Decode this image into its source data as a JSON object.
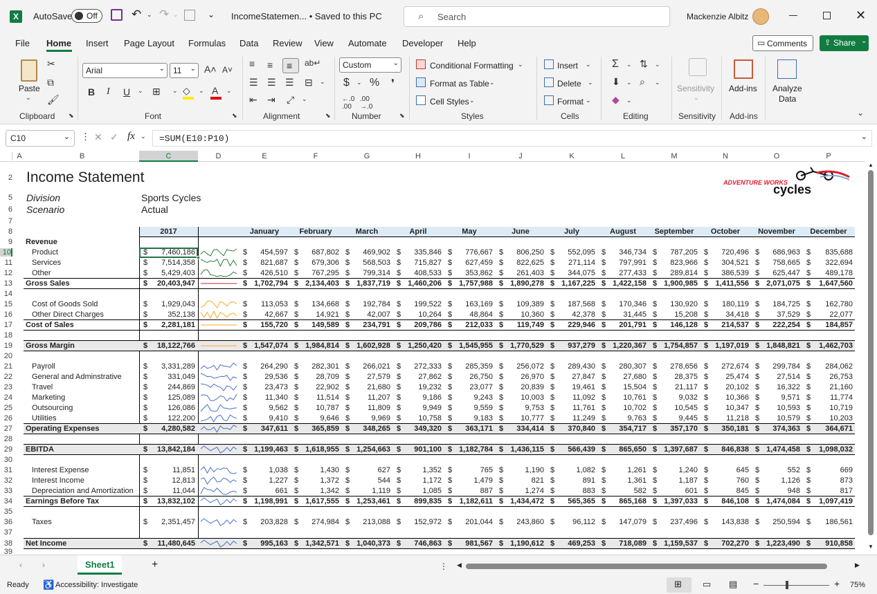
{
  "title_bar": {
    "autosave_label": "AutoSave",
    "autosave_state": "Off",
    "doc_title": "IncomeStatemen... • Saved to this PC",
    "search_placeholder": "Search",
    "user_name": "Mackenzie Albitz"
  },
  "ribbon_tabs": [
    "File",
    "Home",
    "Insert",
    "Page Layout",
    "Formulas",
    "Data",
    "Review",
    "View",
    "Automate",
    "Developer",
    "Help"
  ],
  "comments_label": "Comments",
  "share_label": "Share",
  "clipboard": {
    "paste": "Paste",
    "label": "Clipboard"
  },
  "font": {
    "name": "Arial",
    "size": "11",
    "label": "Font"
  },
  "alignment": {
    "label": "Alignment"
  },
  "number": {
    "format": "Custom",
    "label": "Number"
  },
  "styles": {
    "cond": "Conditional Formatting",
    "table": "Format as Table",
    "cell": "Cell Styles",
    "label": "Styles"
  },
  "cells": {
    "insert": "Insert",
    "delete": "Delete",
    "format": "Format",
    "label": "Cells"
  },
  "editing": {
    "label": "Editing"
  },
  "sensitivity": {
    "btn": "Sensitivity",
    "label": "Sensitivity"
  },
  "addins": {
    "btn": "Add-ins",
    "label": "Add-ins"
  },
  "analyze": {
    "line1": "Analyze",
    "line2": "Data"
  },
  "formula_bar": {
    "name_box": "C10",
    "formula": "=SUM(E10:P10)"
  },
  "columns": [
    "A",
    "B",
    "C",
    "D",
    "E",
    "F",
    "G",
    "H",
    "I",
    "J",
    "K",
    "L",
    "M",
    "N",
    "O",
    "P"
  ],
  "rows": [
    "2",
    "5",
    "6",
    "7",
    "8",
    "9",
    "10",
    "11",
    "12",
    "13",
    "14",
    "15",
    "16",
    "17",
    "18",
    "19",
    "20",
    "21",
    "22",
    "23",
    "24",
    "25",
    "26",
    "27",
    "28",
    "29",
    "30",
    "31",
    "32",
    "33",
    "34",
    "35",
    "36",
    "37",
    "38",
    "39"
  ],
  "sheet": {
    "title": "Income Statement",
    "division_label": "Division",
    "division_value": "Sports Cycles",
    "scenario_label": "Scenario",
    "scenario_value": "Actual",
    "logo_top": "ADVENTURE WORKS",
    "logo_bottom": "cycles",
    "year": "2017",
    "months": [
      "January",
      "February",
      "March",
      "April",
      "May",
      "June",
      "July",
      "August",
      "September",
      "October",
      "November",
      "December"
    ],
    "lines": [
      {
        "row": "9",
        "label": "Revenue",
        "kind": "section",
        "total": "",
        "m": []
      },
      {
        "row": "10",
        "label": "Product",
        "kind": "item",
        "total": "7,460,186",
        "m": [
          "454,597",
          "687,802",
          "469,902",
          "335,846",
          "776,667",
          "806,250",
          "552,095",
          "346,734",
          "787,205",
          "720,496",
          "686,963",
          "835,688"
        ]
      },
      {
        "row": "11",
        "label": "Services",
        "kind": "item",
        "total": "7,514,358",
        "m": [
          "821,687",
          "679,306",
          "568,503",
          "715,827",
          "627,459",
          "822,625",
          "271,114",
          "797,991",
          "823,966",
          "304,521",
          "758,665",
          "322,694"
        ]
      },
      {
        "row": "12",
        "label": "Other",
        "kind": "item",
        "total": "5,429,403",
        "m": [
          "426,510",
          "767,295",
          "799,314",
          "408,533",
          "353,862",
          "261,403",
          "344,075",
          "277,433",
          "289,814",
          "386,539",
          "625,447",
          "489,178"
        ]
      },
      {
        "row": "13",
        "label": "Gross Sales",
        "kind": "total",
        "total": "20,403,947",
        "m": [
          "1,702,794",
          "2,134,403",
          "1,837,719",
          "1,460,206",
          "1,757,988",
          "1,890,278",
          "1,167,225",
          "1,422,158",
          "1,900,985",
          "1,411,556",
          "2,071,075",
          "1,647,560"
        ]
      },
      {
        "row": "15",
        "label": "Cost of Goods Sold",
        "kind": "item",
        "total": "1,929,043",
        "m": [
          "113,053",
          "134,668",
          "192,784",
          "199,522",
          "163,169",
          "109,389",
          "187,568",
          "170,346",
          "130,920",
          "180,119",
          "184,725",
          "162,780"
        ]
      },
      {
        "row": "16",
        "label": "Other Direct Charges",
        "kind": "item",
        "total": "352,138",
        "m": [
          "42,667",
          "14,921",
          "42,007",
          "10,264",
          "48,864",
          "10,360",
          "42,378",
          "31,445",
          "15,208",
          "34,418",
          "37,529",
          "22,077"
        ]
      },
      {
        "row": "17",
        "label": "Cost of Sales",
        "kind": "total",
        "total": "2,281,181",
        "m": [
          "155,720",
          "149,589",
          "234,791",
          "209,786",
          "212,033",
          "119,749",
          "229,946",
          "201,791",
          "146,128",
          "214,537",
          "222,254",
          "184,857"
        ]
      },
      {
        "row": "19",
        "label": "Gross Margin",
        "kind": "grand",
        "total": "18,122,766",
        "m": [
          "1,547,074",
          "1,984,814",
          "1,602,928",
          "1,250,420",
          "1,545,955",
          "1,770,529",
          "937,279",
          "1,220,367",
          "1,754,857",
          "1,197,019",
          "1,848,821",
          "1,462,703"
        ]
      },
      {
        "row": "21",
        "label": "Payroll",
        "kind": "item",
        "total": "3,331,289",
        "m": [
          "264,290",
          "282,301",
          "266,021",
          "272,333",
          "285,359",
          "256,072",
          "289,430",
          "280,307",
          "278,656",
          "272,674",
          "299,784",
          "284,062"
        ]
      },
      {
        "row": "22",
        "label": "General and Adminstrative",
        "kind": "item",
        "total": "331,049",
        "m": [
          "29,536",
          "28,709",
          "27,579",
          "27,862",
          "26,750",
          "26,970",
          "27,847",
          "27,680",
          "28,375",
          "25,474",
          "27,514",
          "26,753"
        ]
      },
      {
        "row": "23",
        "label": "Travel",
        "kind": "item",
        "total": "244,869",
        "m": [
          "23,473",
          "22,902",
          "21,680",
          "19,232",
          "23,077",
          "20,839",
          "19,461",
          "15,504",
          "21,117",
          "20,102",
          "16,322",
          "21,160"
        ]
      },
      {
        "row": "24",
        "label": "Marketing",
        "kind": "item",
        "total": "125,089",
        "m": [
          "11,340",
          "11,514",
          "11,207",
          "9,186",
          "9,243",
          "10,003",
          "11,092",
          "10,761",
          "9,032",
          "10,366",
          "9,571",
          "11,774"
        ]
      },
      {
        "row": "25",
        "label": "Outsourcing",
        "kind": "item",
        "total": "126,086",
        "m": [
          "9,562",
          "10,787",
          "11,809",
          "9,949",
          "9,559",
          "9,753",
          "11,761",
          "10,702",
          "10,545",
          "10,347",
          "10,593",
          "10,719"
        ]
      },
      {
        "row": "26",
        "label": "Utilities",
        "kind": "item",
        "total": "122,200",
        "m": [
          "9,410",
          "9,646",
          "9,969",
          "10,758",
          "9,183",
          "10,777",
          "11,249",
          "9,763",
          "9,445",
          "11,218",
          "10,579",
          "10,203"
        ]
      },
      {
        "row": "27",
        "label": "Operating Expenses",
        "kind": "grand",
        "total": "4,280,582",
        "m": [
          "347,611",
          "365,859",
          "348,265",
          "349,320",
          "363,171",
          "334,414",
          "370,840",
          "354,717",
          "357,170",
          "350,181",
          "374,363",
          "364,671"
        ]
      },
      {
        "row": "29",
        "label": "EBITDA",
        "kind": "grand",
        "total": "13,842,184",
        "m": [
          "1,199,463",
          "1,618,955",
          "1,254,663",
          "901,100",
          "1,182,784",
          "1,436,115",
          "566,439",
          "865,650",
          "1,397,687",
          "846,838",
          "1,474,458",
          "1,098,032"
        ]
      },
      {
        "row": "31",
        "label": "Interest Expense",
        "kind": "item",
        "total": "11,851",
        "m": [
          "1,038",
          "1,430",
          "627",
          "1,352",
          "765",
          "1,190",
          "1,082",
          "1,261",
          "1,240",
          "645",
          "552",
          "669"
        ]
      },
      {
        "row": "32",
        "label": "Interest Income",
        "kind": "item",
        "total": "12,813",
        "m": [
          "1,227",
          "1,372",
          "544",
          "1,172",
          "1,479",
          "821",
          "891",
          "1,361",
          "1,187",
          "760",
          "1,126",
          "873"
        ]
      },
      {
        "row": "33",
        "label": "Depreciation and Amortization",
        "kind": "item",
        "total": "11,044",
        "m": [
          "661",
          "1,342",
          "1,119",
          "1,085",
          "887",
          "1,274",
          "883",
          "582",
          "601",
          "845",
          "948",
          "817"
        ]
      },
      {
        "row": "34",
        "label": "Earnings Before Tax",
        "kind": "total",
        "total": "13,832,102",
        "m": [
          "1,198,991",
          "1,617,555",
          "1,253,461",
          "899,835",
          "1,182,611",
          "1,434,472",
          "565,365",
          "865,168",
          "1,397,033",
          "846,108",
          "1,474,084",
          "1,097,419"
        ]
      },
      {
        "row": "36",
        "label": "Taxes",
        "kind": "item",
        "total": "2,351,457",
        "m": [
          "203,828",
          "274,984",
          "213,088",
          "152,972",
          "201,044",
          "243,860",
          "96,112",
          "147,079",
          "237,496",
          "143,838",
          "250,594",
          "186,561"
        ]
      },
      {
        "row": "38",
        "label": "Net Income",
        "kind": "grand",
        "total": "11,480,645",
        "m": [
          "995,163",
          "1,342,571",
          "1,040,373",
          "746,863",
          "981,567",
          "1,190,612",
          "469,253",
          "718,089",
          "1,159,537",
          "702,270",
          "1,223,490",
          "910,858"
        ]
      }
    ]
  },
  "sheet_tab": "Sheet1",
  "status": {
    "ready": "Ready",
    "accessibility": "Accessibility: Investigate",
    "zoom": "75%"
  },
  "colors": {
    "excel_green": "#107c41",
    "header_blue": "#ddebf7",
    "selection_green": "#217346"
  }
}
